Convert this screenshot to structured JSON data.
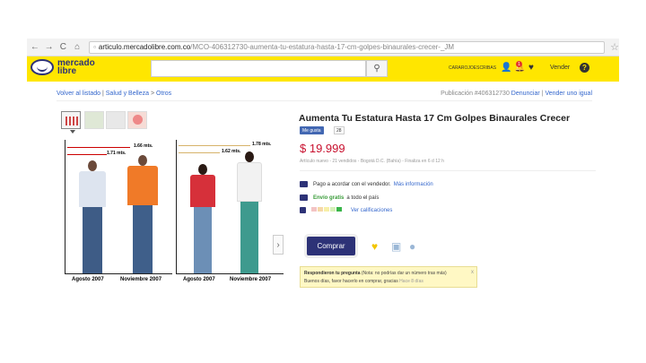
{
  "browser": {
    "url_host": "articulo.mercadolibre.com.co",
    "url_path": "/MCO-406312730-aumenta-tu-estatura-hasta-17-cm-golpes-binaurales-crecer-_JM",
    "back_icon": "back-arrow-icon",
    "forward_icon": "forward-arrow-icon",
    "reload_icon": "reload-icon",
    "home_icon": "home-icon"
  },
  "header": {
    "logo_line1": "mercado",
    "logo_line2": "libre",
    "search_placeholder": "",
    "user_label": "CARAROJOESCRIBAS",
    "notif_count": "1",
    "vender": "Vender",
    "help": "?",
    "brand_color": "#ffe600"
  },
  "breadcrumb": {
    "back": "Volver al listado",
    "sep1": "|",
    "cat1": "Salud y Belleza",
    "sep2": ">",
    "cat2": "Otros"
  },
  "pubinfo": {
    "prefix": "Publicación #406312730",
    "report": "Denunciar",
    "sell_same": "Vender uno igual",
    "divider": "|"
  },
  "gallery": {
    "captions": [
      "Agosto 2007",
      "Noviembre 2007",
      "Agosto 2007",
      "Noviembre 2007"
    ],
    "heights": [
      "1.66 mts.",
      "1.71 mts.",
      "1.62 mts.",
      "1.78 mts."
    ],
    "next_icon": "chevron-right-icon"
  },
  "product": {
    "title": "Aumenta Tu Estatura Hasta 17 Cm Golpes Binaurales Crecer",
    "fb_label": "Me gusta",
    "fb_count": "28",
    "price": "$ 19.999",
    "subinfo": "Artículo nuevo  -  21 vendidos  -  Bogotá D.C. (Bahía)  -  Finaliza en 6 d 12 h",
    "payment": "Pago a acordar con el vendedor.",
    "payment_link": "Más información",
    "shipping_green": "Envío gratis",
    "shipping_rest": "a todo el país",
    "reputation_link": "Ver calificaciones",
    "buy": "Comprar"
  },
  "notice": {
    "title": "Respondieron tu pregunta",
    "hint": "(Nota: no podrías dar un número tras más)",
    "body": "Buenos días, favor hacerlo en comprar, gracias",
    "when": "Hace 8 días",
    "close": "x"
  }
}
